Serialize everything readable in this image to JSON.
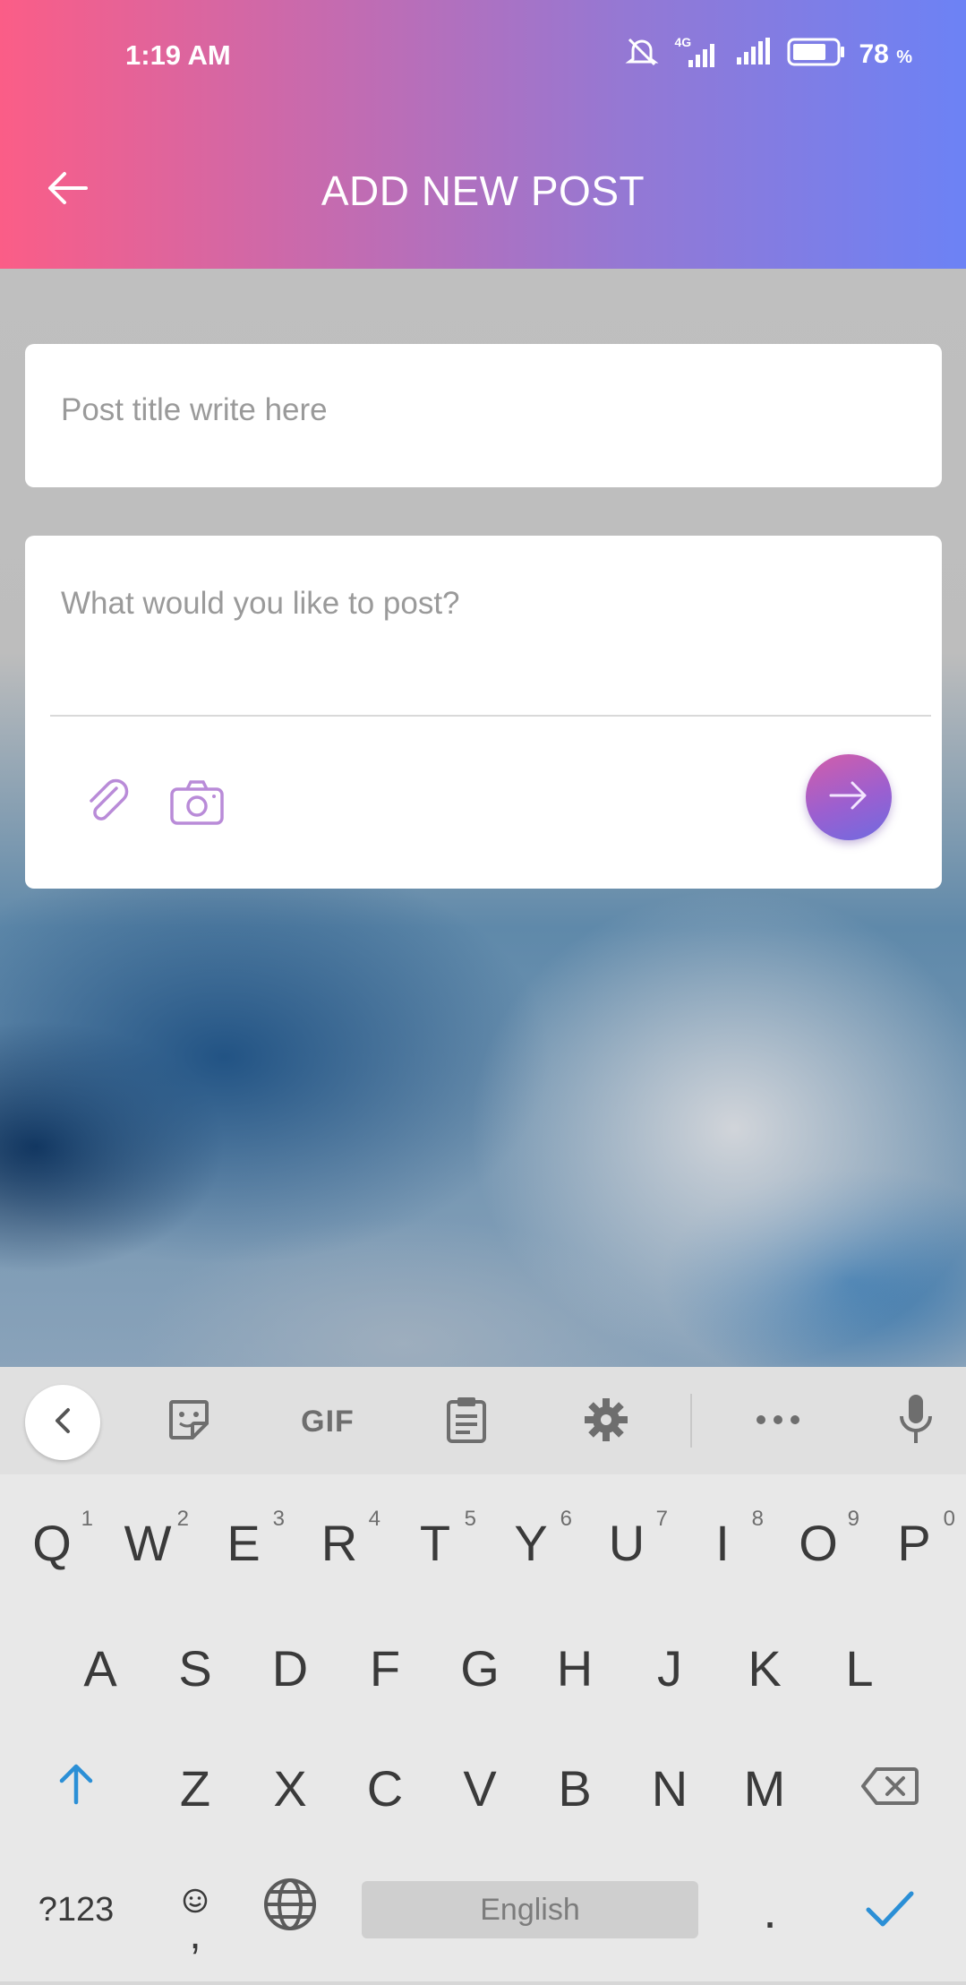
{
  "status_bar": {
    "time": "1:19 AM",
    "network": "4G",
    "battery_percent": "78",
    "battery_unit": "%",
    "battery_level": 0.78,
    "icons": [
      "silent-bell-icon",
      "signal-4g-icon",
      "signal-icon",
      "battery-icon"
    ]
  },
  "header": {
    "title": "ADD NEW POST",
    "back_icon": "arrow-left-icon",
    "gradient_colors": [
      "#fb5d87",
      "#c46bb0",
      "#9478d4",
      "#6c82f5"
    ]
  },
  "form": {
    "title_placeholder": "Post title write here",
    "title_value": "",
    "post_placeholder": "What would you like to post?",
    "post_value": "",
    "attach_icon": "paperclip-icon",
    "camera_icon": "camera-icon",
    "send_icon": "arrow-right-icon",
    "accent_color": "#9b5fd0"
  },
  "keyboard": {
    "toolbar": [
      "chevron-left-icon",
      "sticker-icon",
      "GIF",
      "clipboard-icon",
      "gear-icon",
      "more-icon",
      "microphone-icon"
    ],
    "gif_label": "GIF",
    "row1": [
      {
        "key": "Q",
        "num": "1"
      },
      {
        "key": "W",
        "num": "2"
      },
      {
        "key": "E",
        "num": "3"
      },
      {
        "key": "R",
        "num": "4"
      },
      {
        "key": "T",
        "num": "5"
      },
      {
        "key": "Y",
        "num": "6"
      },
      {
        "key": "U",
        "num": "7"
      },
      {
        "key": "I",
        "num": "8"
      },
      {
        "key": "O",
        "num": "9"
      },
      {
        "key": "P",
        "num": "0"
      }
    ],
    "row2": [
      "A",
      "S",
      "D",
      "F",
      "G",
      "H",
      "J",
      "K",
      "L"
    ],
    "row3": [
      "Z",
      "X",
      "C",
      "V",
      "B",
      "N",
      "M"
    ],
    "symbols_label": "?123",
    "emoji_comma": ",",
    "space_label": "English",
    "period": ".",
    "shift_color": "#2b8fd6",
    "enter_color": "#2b8fd6"
  }
}
